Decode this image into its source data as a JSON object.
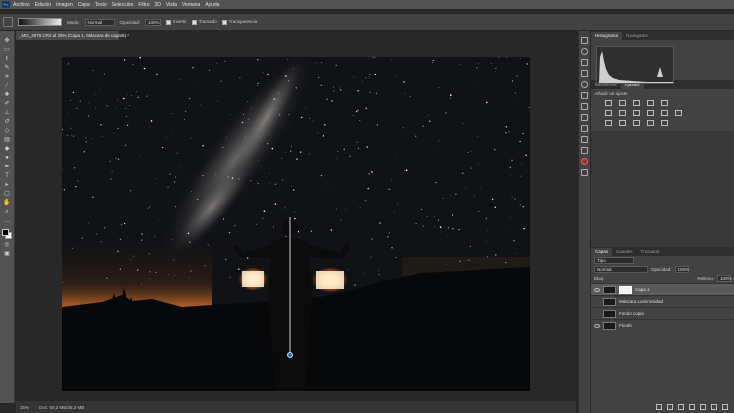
{
  "menu": {
    "items": [
      "Archivo",
      "Edición",
      "Imagen",
      "Capa",
      "Texto",
      "Selección",
      "Filtro",
      "3D",
      "Vista",
      "Ventana",
      "Ayuda"
    ]
  },
  "options": {
    "mode_label": "Modo:",
    "mode_value": "Normal",
    "opacity_label": "Opacidad:",
    "opacity_value": "100%",
    "invert_label": "Invertir",
    "dither_label": "Tramado",
    "transparency_label": "Transparencia"
  },
  "document": {
    "tab_title": "_MG_4876.CR2 al 25% (Capa 1, Máscara de capa/8) *",
    "zoom": "25%",
    "doc_info": "Doc: 50,2 MB/38,3 MB"
  },
  "panels": {
    "top_tabs": [
      "Histograma",
      "Navegador"
    ],
    "mid_tabs": [
      "Bibliotecas",
      "Ajustes"
    ],
    "adjustments_title": "Añadir un ajuste",
    "layer_tabs": [
      "Capas",
      "Canales",
      "Trazados"
    ],
    "filter_value": "Tipo",
    "blend_value": "Normal",
    "opacity_label": "Opacidad:",
    "opacity_value": "100%",
    "lock_label": "Bloq:",
    "fill_label": "Relleno:",
    "fill_value": "100%",
    "layers": [
      {
        "name": "Capa 1"
      },
      {
        "name": "Máscara Luminosidad"
      },
      {
        "name": "Fondo copia"
      },
      {
        "name": "Fondo"
      }
    ]
  },
  "colors": {
    "accent": "#31a8ff",
    "sky_light": "#d9742a",
    "panel_bg": "#424242"
  }
}
